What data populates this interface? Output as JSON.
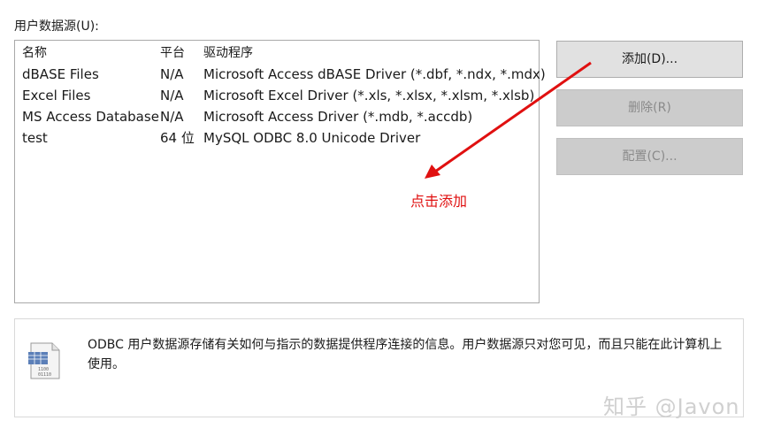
{
  "section_label": "用户数据源(U):",
  "table": {
    "headers": {
      "name": "名称",
      "platform": "平台",
      "driver": "驱动程序"
    },
    "rows": [
      {
        "name": "dBASE Files",
        "platform": "N/A",
        "driver": "Microsoft Access dBASE Driver (*.dbf, *.ndx, *.mdx)"
      },
      {
        "name": "Excel Files",
        "platform": "N/A",
        "driver": "Microsoft Excel Driver (*.xls, *.xlsx, *.xlsm, *.xlsb)"
      },
      {
        "name": "MS Access Database",
        "platform": "N/A",
        "driver": "Microsoft Access Driver (*.mdb, *.accdb)"
      },
      {
        "name": "test",
        "platform": "64 位",
        "driver": "MySQL ODBC 8.0 Unicode Driver"
      }
    ]
  },
  "buttons": {
    "add": "添加(D)...",
    "remove": "删除(R)",
    "configure": "配置(C)..."
  },
  "annotation": {
    "text": "点击添加",
    "color": "#e01010"
  },
  "info": {
    "text": "ODBC 用户数据源存储有关如何与指示的数据提供程序连接的信息。用户数据源只对您可见，而且只能在此计算机上使用。",
    "icon": "data-source-icon"
  },
  "watermark": "知乎 @Javon"
}
